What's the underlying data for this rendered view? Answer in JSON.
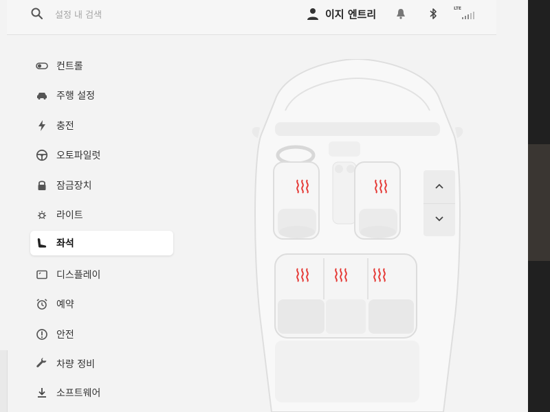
{
  "topbar": {
    "search_placeholder": "설정 내 검색",
    "profile_name": "이지 엔트리",
    "network_label": "LTE"
  },
  "sidebar": {
    "items": [
      {
        "label": "컨트롤",
        "icon": "toggle-icon",
        "active": false
      },
      {
        "label": "주행 설정",
        "icon": "car-icon",
        "active": false
      },
      {
        "label": "충전",
        "icon": "bolt-icon",
        "active": false
      },
      {
        "label": "오토파일럿",
        "icon": "steering-wheel-icon",
        "active": false
      },
      {
        "label": "잠금장치",
        "icon": "lock-icon",
        "active": false
      },
      {
        "label": "라이트",
        "icon": "light-icon",
        "active": false
      },
      {
        "label": "좌석",
        "icon": "seat-icon",
        "active": true
      },
      {
        "label": "디스플레이",
        "icon": "display-icon",
        "active": false
      },
      {
        "label": "예약",
        "icon": "alarm-clock-icon",
        "active": false
      },
      {
        "label": "안전",
        "icon": "safety-icon",
        "active": false
      },
      {
        "label": "차량 정비",
        "icon": "wrench-icon",
        "active": false
      },
      {
        "label": "소프트웨어",
        "icon": "download-icon",
        "active": false
      }
    ]
  },
  "seats": {
    "heated": [
      "front-left",
      "front-right",
      "rear-left",
      "rear-center",
      "rear-right"
    ],
    "heat_color": "#e53935"
  },
  "colors": {
    "background": "#f3f3f3",
    "active_item": "#ffffff",
    "text": "#333333"
  }
}
